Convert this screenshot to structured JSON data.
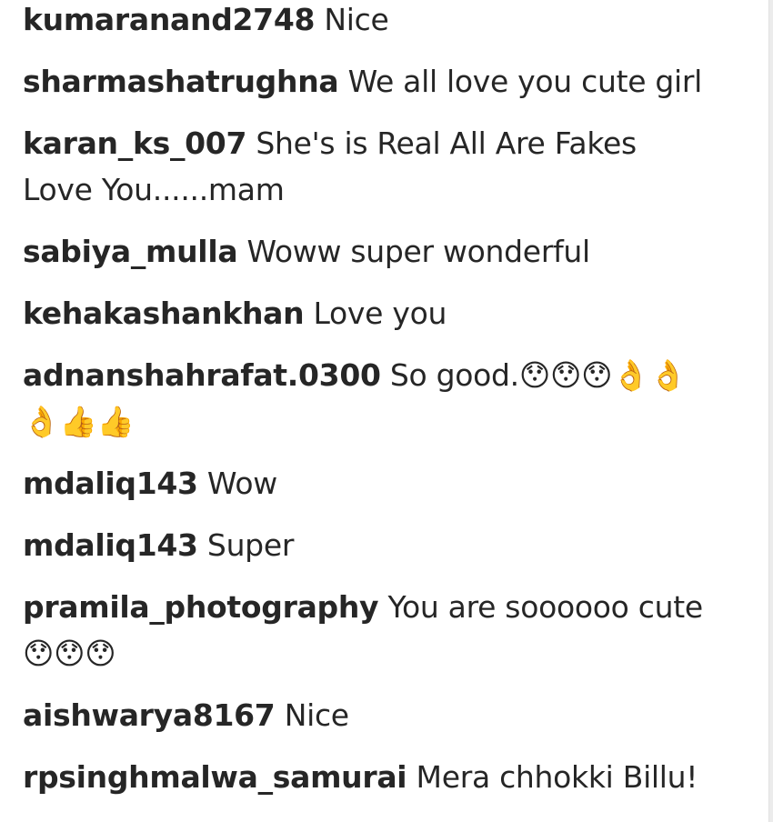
{
  "comments": [
    {
      "username": "kumaranand2748",
      "text": "Nice"
    },
    {
      "username": "sharmashatrughna",
      "text": "We all love you cute girl"
    },
    {
      "username": "karan_ks_007",
      "text": "She's is Real All Are Fakes Love You......mam"
    },
    {
      "username": "sabiya_mulla",
      "text": "Woww super wonderful"
    },
    {
      "username": "kehakashankhan",
      "text": "Love you"
    },
    {
      "username": "adnanshahrafat.0300",
      "text": "So good.😯😯😯👌👌👌👍👍"
    },
    {
      "username": "mdaliq143",
      "text": "Wow"
    },
    {
      "username": "mdaliq143",
      "text": "Super"
    },
    {
      "username": "pramila_photography",
      "text": "You are soooooo cute😯😯😯"
    },
    {
      "username": "aishwarya8167",
      "text": "Nice"
    },
    {
      "username": "rpsinghmalwa_samurai",
      "text": "Mera chhokki Billu!"
    }
  ]
}
